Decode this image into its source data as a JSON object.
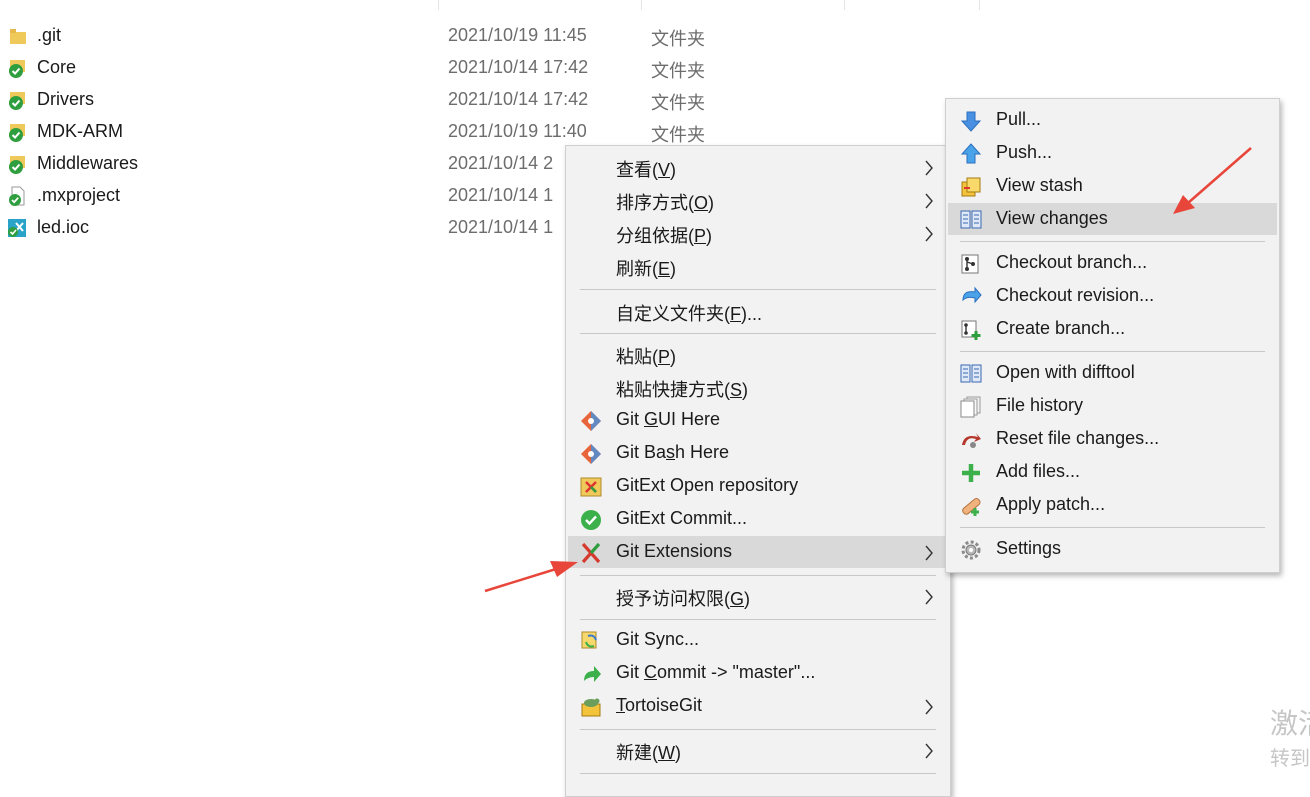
{
  "files": [
    {
      "name": ".git",
      "date": "2021/10/19 11:45",
      "type": "文件夹",
      "icon": "folder-icon"
    },
    {
      "name": "Core",
      "date": "2021/10/14 17:42",
      "type": "文件夹",
      "icon": "git-folder-icon"
    },
    {
      "name": "Drivers",
      "date": "2021/10/14 17:42",
      "type": "文件夹",
      "icon": "git-folder-icon"
    },
    {
      "name": "MDK-ARM",
      "date": "2021/10/19 11:40",
      "type": "文件夹",
      "icon": "git-folder-icon"
    },
    {
      "name": "Middlewares",
      "date": "2021/10/14 2",
      "type": "",
      "icon": "git-folder-icon"
    },
    {
      "name": ".mxproject",
      "date": "2021/10/14 1",
      "type": "",
      "icon": "git-file-icon"
    },
    {
      "name": "led.ioc",
      "date": "2021/10/14 1",
      "type": "",
      "icon": "git-ioc-icon"
    }
  ],
  "context_menu": {
    "items": [
      {
        "label": "查看(V)",
        "pre": "查看(",
        "acc": "V",
        "post": ")",
        "submenu": true
      },
      {
        "label": "排序方式(O)",
        "pre": "排序方式(",
        "acc": "O",
        "post": ")",
        "submenu": true
      },
      {
        "label": "分组依据(P)",
        "pre": "分组依据(",
        "acc": "P",
        "post": ")",
        "submenu": true
      },
      {
        "label": "刷新(E)",
        "pre": "刷新(",
        "acc": "E",
        "post": ")"
      },
      {
        "label": "自定义文件夹(F)...",
        "pre": "自定义文件夹(",
        "acc": "F",
        "post": ")..."
      },
      {
        "label": "粘贴(P)",
        "pre": "粘贴(",
        "acc": "P",
        "post": ")"
      },
      {
        "label": "粘贴快捷方式(S)",
        "pre": "粘贴快捷方式(",
        "acc": "S",
        "post": ")"
      },
      {
        "label": "Git GUI Here",
        "pre": "Git ",
        "acc": "G",
        "post": "UI Here",
        "icon": "git-gui-icon"
      },
      {
        "label": "Git Bash Here",
        "pre": "Git Ba",
        "acc": "s",
        "post": "h Here",
        "icon": "git-bash-icon"
      },
      {
        "label": "GitExt Open repository",
        "pre": "GitExt Open repository",
        "acc": "",
        "post": "",
        "icon": "gitext-repo-icon"
      },
      {
        "label": "GitExt Commit...",
        "pre": "GitExt Commit...",
        "acc": "",
        "post": "",
        "icon": "gitext-commit-icon"
      },
      {
        "label": "Git Extensions",
        "pre": "Git Extensions",
        "acc": "",
        "post": "",
        "icon": "git-extensions-icon",
        "submenu": true,
        "highlighted": true
      },
      {
        "label": "授予访问权限(G)",
        "pre": "授予访问权限(",
        "acc": "G",
        "post": ")",
        "submenu": true
      },
      {
        "label": "Git Sync...",
        "pre": "Git Sync...",
        "acc": "",
        "post": "",
        "icon": "git-sync-icon"
      },
      {
        "label": "Git Commit -> \"master\"...",
        "pre": "Git ",
        "acc": "C",
        "post": "ommit -> \"master\"...",
        "icon": "git-commit-icon"
      },
      {
        "label": "TortoiseGit",
        "pre": "",
        "acc": "T",
        "post": "ortoiseGit",
        "icon": "tortoisegit-icon",
        "submenu": true
      },
      {
        "label": "新建(W)",
        "pre": "新建(",
        "acc": "W",
        "post": ")",
        "submenu": true
      }
    ]
  },
  "git_extensions_menu": {
    "items": [
      {
        "label": "Pull...",
        "icon": "pull-arrow-icon"
      },
      {
        "label": "Push...",
        "icon": "push-arrow-icon"
      },
      {
        "label": "View stash",
        "icon": "stash-icon"
      },
      {
        "label": "View changes",
        "icon": "changes-icon",
        "highlighted": true
      },
      {
        "label": "Checkout branch...",
        "icon": "checkout-branch-icon"
      },
      {
        "label": "Checkout revision...",
        "icon": "checkout-revision-icon"
      },
      {
        "label": "Create branch...",
        "icon": "create-branch-icon"
      },
      {
        "label": "Open with difftool",
        "icon": "difftool-icon"
      },
      {
        "label": "File history",
        "icon": "file-history-icon"
      },
      {
        "label": "Reset file changes...",
        "icon": "reset-icon"
      },
      {
        "label": "Add files...",
        "icon": "add-files-icon"
      },
      {
        "label": "Apply patch...",
        "icon": "patch-icon"
      },
      {
        "label": "Settings",
        "icon": "settings-gear-icon"
      }
    ]
  },
  "watermark": {
    "line1": "激活",
    "line2": "转到"
  },
  "colors": {
    "menu_bg": "#f2f2f2",
    "highlight": "#d9d9d9",
    "annotation_arrow": "#e8463a",
    "git_green": "#2e9e3e"
  }
}
